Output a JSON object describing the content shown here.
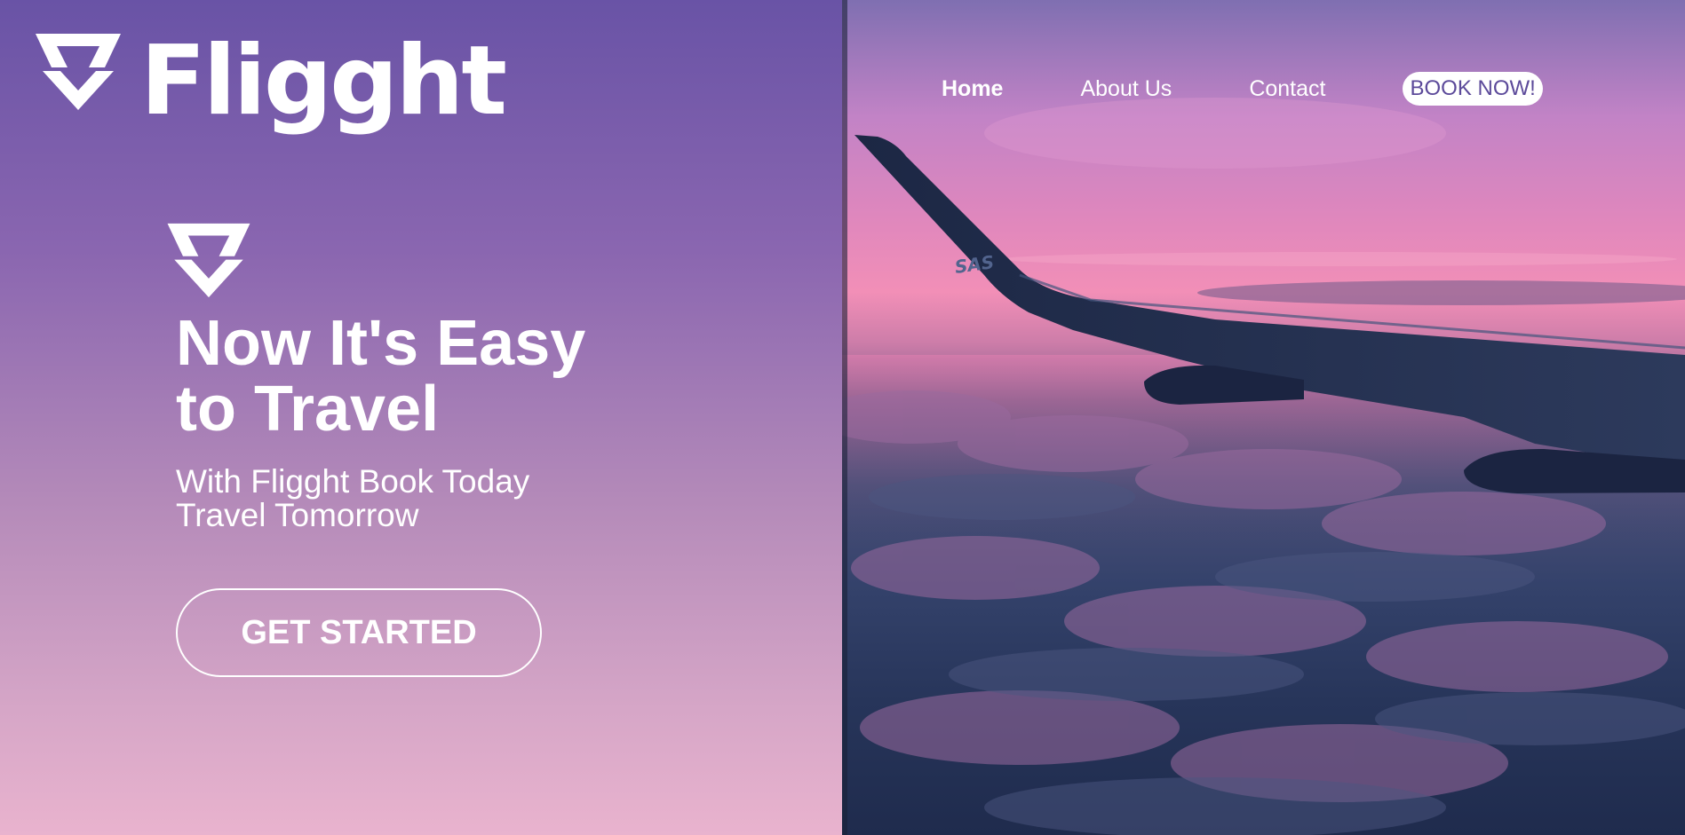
{
  "brand": {
    "name": "Fligght",
    "logo_icon": "chevron-v-logo-icon"
  },
  "nav": {
    "home_label": "Home",
    "about_label": "About Us",
    "contact_label": "Contact",
    "book_label": "BOOK NOW!"
  },
  "hero": {
    "logo_icon": "chevron-v-logo-icon",
    "title_line1": "Now It's Easy",
    "title_line2": "to Travel",
    "subtitle_line1": "With Fligght Book Today",
    "subtitle_line2": "Travel Tomorrow",
    "cta_label": "GET STARTED"
  },
  "photo": {
    "subject": "airplane-wing-above-clouds",
    "wing_marking": "SAS"
  },
  "colors": {
    "gradient_top": "#6953a6",
    "gradient_bottom": "#e9b3ce",
    "book_text": "#5c4a9a",
    "white": "#ffffff"
  }
}
